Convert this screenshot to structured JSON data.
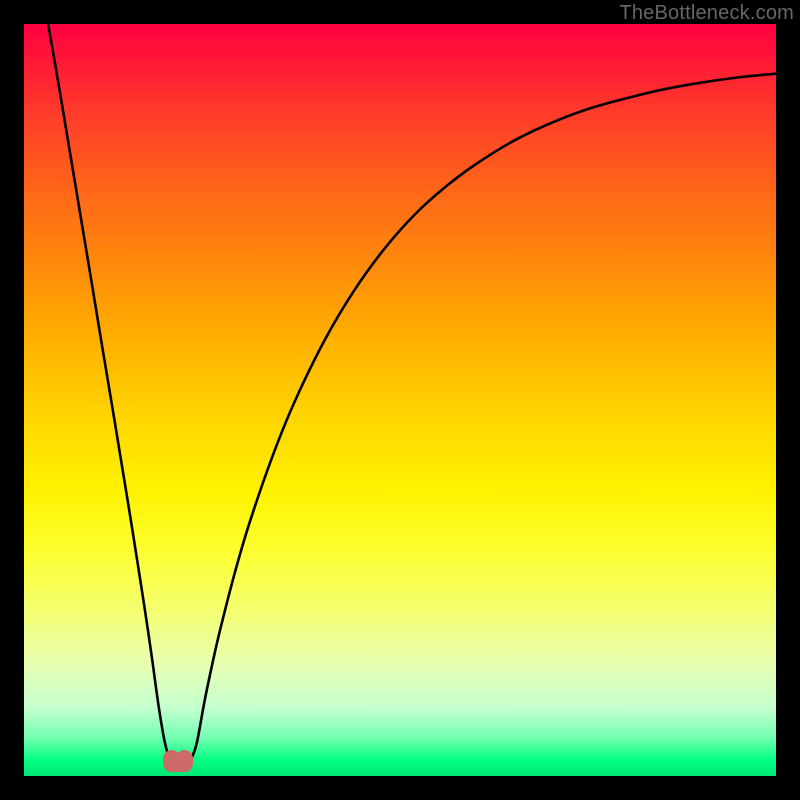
{
  "attribution": "TheBottleneck.com",
  "colors": {
    "frame": "#000000",
    "attribution_text": "#666666",
    "curve_stroke": "#000000",
    "blob": "#cb6a69",
    "gradient_top": "#ff0040",
    "gradient_bottom": "#00e676"
  },
  "chart_data": {
    "type": "line",
    "title": "",
    "xlabel": "",
    "ylabel": "",
    "xlim": [
      0,
      100
    ],
    "ylim": [
      0,
      100
    ],
    "grid": false,
    "legend": false,
    "series": [
      {
        "name": "left-branch",
        "x": [
          3.2,
          4,
          5,
          6,
          7,
          8,
          9,
          10,
          11,
          12,
          13,
          14,
          15,
          16,
          17,
          17.9,
          18.7,
          19.3
        ],
        "y": [
          100,
          95.5,
          89.6,
          83.6,
          77.6,
          71.6,
          65.6,
          59.5,
          53.5,
          47.5,
          41.4,
          35.3,
          29,
          22.6,
          15.8,
          9.3,
          4.6,
          2.4
        ]
      },
      {
        "name": "right-branch",
        "x": [
          22.3,
          23,
          24,
          25,
          26,
          28,
          30,
          33,
          36,
          40,
          44,
          48,
          52,
          56,
          60,
          65,
          70,
          75,
          80,
          85,
          90,
          95,
          100
        ],
        "y": [
          2.4,
          4.5,
          9.9,
          14.7,
          19.1,
          26.9,
          33.7,
          42.4,
          49.8,
          58,
          64.7,
          70.2,
          74.7,
          78.3,
          81.3,
          84.4,
          86.8,
          88.7,
          90.1,
          91.3,
          92.2,
          92.9,
          93.4
        ]
      },
      {
        "name": "valley-blob",
        "x": [
          19.3,
          19.8,
          20.2,
          20.8,
          21.5,
          22.3
        ],
        "y": [
          2.4,
          1.6,
          1.3,
          1.3,
          1.6,
          2.4
        ]
      }
    ],
    "annotations": []
  }
}
